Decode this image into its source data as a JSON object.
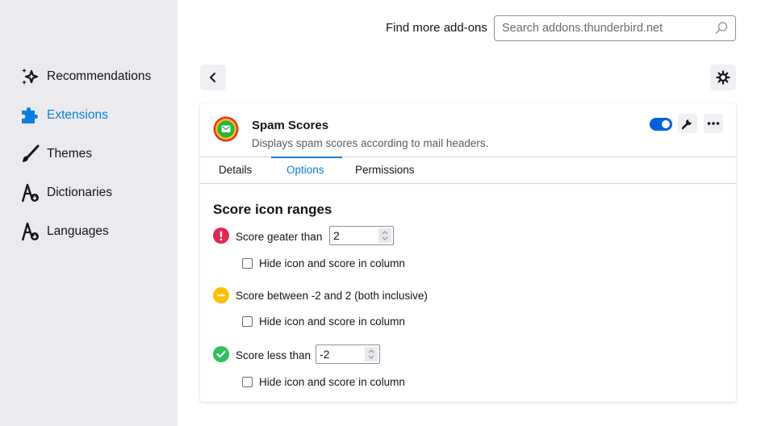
{
  "sidebar": {
    "items": [
      {
        "label": "Recommendations",
        "icon": "sparkle-icon",
        "active": false
      },
      {
        "label": "Extensions",
        "icon": "puzzle-icon",
        "active": true
      },
      {
        "label": "Themes",
        "icon": "brush-icon",
        "active": false
      },
      {
        "label": "Dictionaries",
        "icon": "dictionary-icon",
        "active": false
      },
      {
        "label": "Languages",
        "icon": "language-icon",
        "active": false
      }
    ]
  },
  "header": {
    "find_label": "Find more add-ons",
    "search_placeholder": "Search addons.thunderbird.net"
  },
  "addon": {
    "name": "Spam Scores",
    "description": "Displays spam scores according to mail headers.",
    "enabled": true
  },
  "tabs": [
    {
      "label": "Details",
      "active": false
    },
    {
      "label": "Options",
      "active": true
    },
    {
      "label": "Permissions",
      "active": false
    }
  ],
  "options": {
    "title": "Score icon ranges",
    "high": {
      "label": "Score geater than",
      "value": "2",
      "checkbox_label": "Hide icon and score in column",
      "checked": false,
      "color": "#e22850"
    },
    "mid": {
      "label": "Score between -2 and 2 (both inclusive)",
      "checkbox_label": "Hide icon and score in column",
      "checked": false,
      "color": "#ffbf00"
    },
    "low": {
      "label": "Score less than",
      "value": "-2",
      "checkbox_label": "Hide icon and score in column",
      "checked": false,
      "color": "#2ac35b"
    }
  },
  "colors": {
    "accent": "#0b7ee0",
    "toggle": "#0061e0",
    "sidebar_bg": "#ebebef"
  }
}
